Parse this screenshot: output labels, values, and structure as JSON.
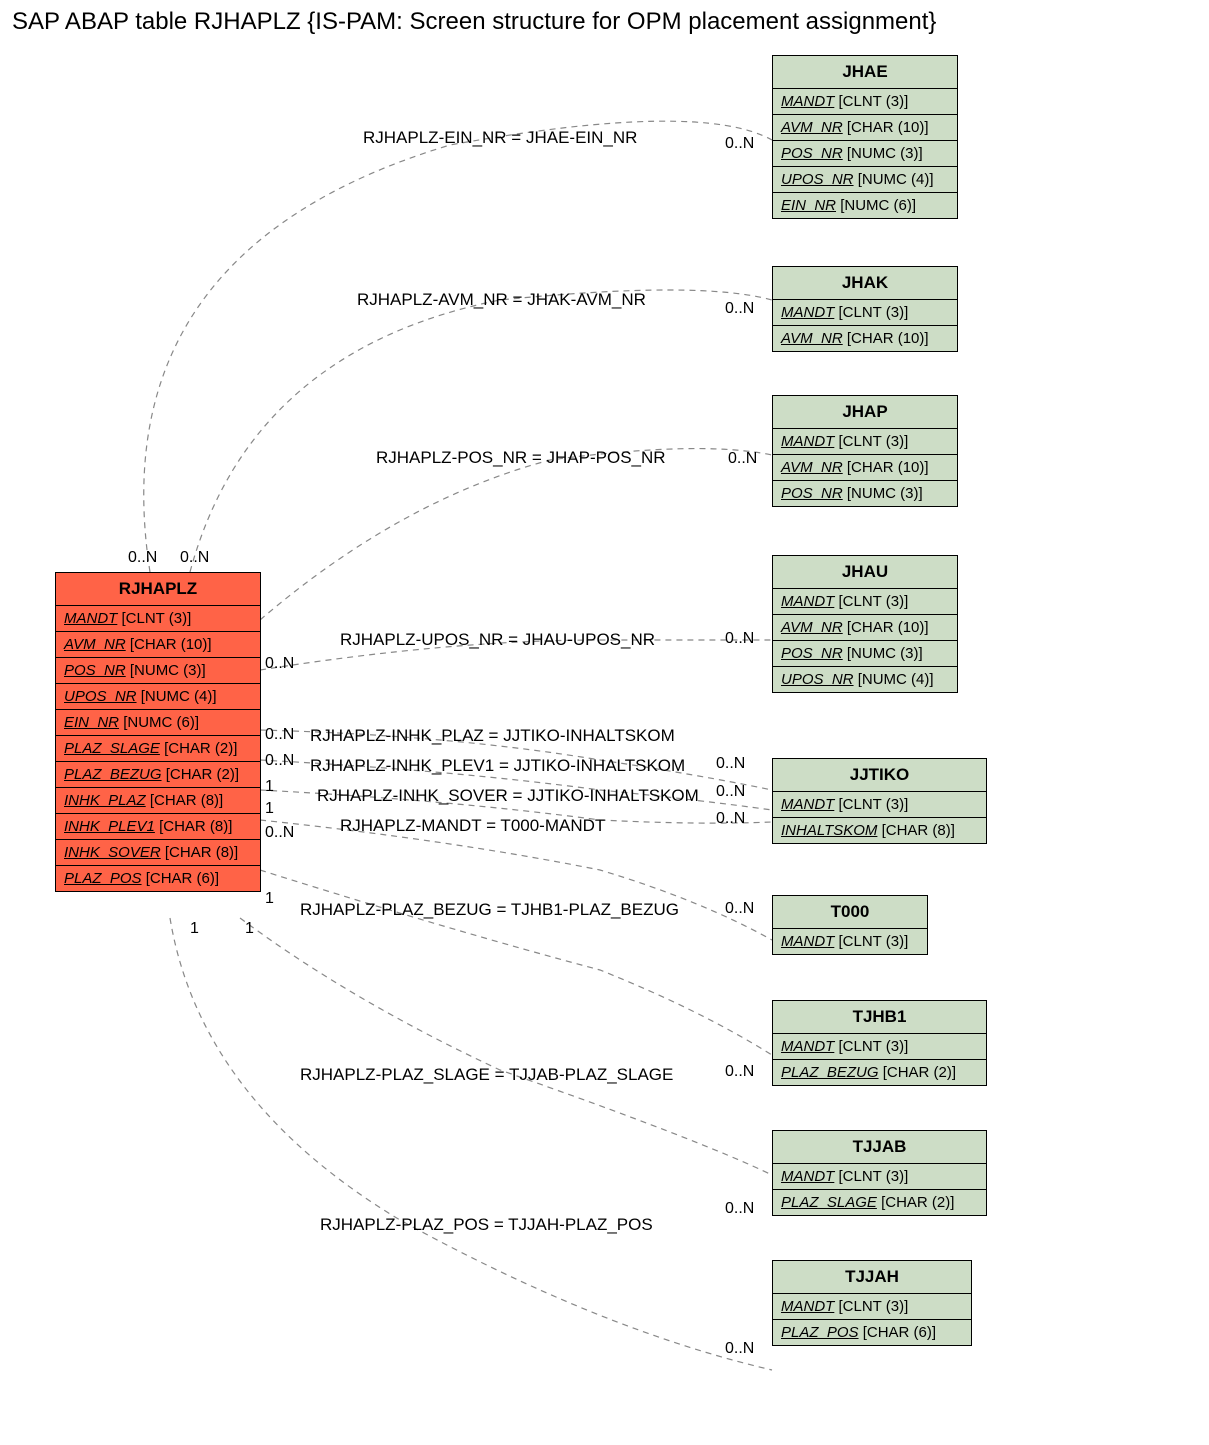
{
  "title": "SAP ABAP table RJHAPLZ {IS-PAM: Screen structure for OPM placement assignment}",
  "main": {
    "name": "RJHAPLZ",
    "fields": [
      {
        "name": "MANDT",
        "type": "[CLNT (3)]"
      },
      {
        "name": "AVM_NR",
        "type": "[CHAR (10)]"
      },
      {
        "name": "POS_NR",
        "type": "[NUMC (3)]"
      },
      {
        "name": "UPOS_NR",
        "type": "[NUMC (4)]"
      },
      {
        "name": "EIN_NR",
        "type": "[NUMC (6)]"
      },
      {
        "name": "PLAZ_SLAGE",
        "type": "[CHAR (2)]"
      },
      {
        "name": "PLAZ_BEZUG",
        "type": "[CHAR (2)]"
      },
      {
        "name": "INHK_PLAZ",
        "type": "[CHAR (8)]"
      },
      {
        "name": "INHK_PLEV1",
        "type": "[CHAR (8)]"
      },
      {
        "name": "INHK_SOVER",
        "type": "[CHAR (8)]"
      },
      {
        "name": "PLAZ_POS",
        "type": "[CHAR (6)]"
      }
    ]
  },
  "related": [
    {
      "name": "JHAE",
      "fields": [
        {
          "name": "MANDT",
          "type": "[CLNT (3)]"
        },
        {
          "name": "AVM_NR",
          "type": "[CHAR (10)]"
        },
        {
          "name": "POS_NR",
          "type": "[NUMC (3)]"
        },
        {
          "name": "UPOS_NR",
          "type": "[NUMC (4)]"
        },
        {
          "name": "EIN_NR",
          "type": "[NUMC (6)]"
        }
      ]
    },
    {
      "name": "JHAK",
      "fields": [
        {
          "name": "MANDT",
          "type": "[CLNT (3)]"
        },
        {
          "name": "AVM_NR",
          "type": "[CHAR (10)]"
        }
      ]
    },
    {
      "name": "JHAP",
      "fields": [
        {
          "name": "MANDT",
          "type": "[CLNT (3)]"
        },
        {
          "name": "AVM_NR",
          "type": "[CHAR (10)]"
        },
        {
          "name": "POS_NR",
          "type": "[NUMC (3)]"
        }
      ]
    },
    {
      "name": "JHAU",
      "fields": [
        {
          "name": "MANDT",
          "type": "[CLNT (3)]"
        },
        {
          "name": "AVM_NR",
          "type": "[CHAR (10)]"
        },
        {
          "name": "POS_NR",
          "type": "[NUMC (3)]"
        },
        {
          "name": "UPOS_NR",
          "type": "[NUMC (4)]"
        }
      ]
    },
    {
      "name": "JJTIKO",
      "fields": [
        {
          "name": "MANDT",
          "type": "[CLNT (3)]"
        },
        {
          "name": "INHALTSKOM",
          "type": "[CHAR (8)]"
        }
      ]
    },
    {
      "name": "T000",
      "fields": [
        {
          "name": "MANDT",
          "type": "[CLNT (3)]"
        }
      ]
    },
    {
      "name": "TJHB1",
      "fields": [
        {
          "name": "MANDT",
          "type": "[CLNT (3)]"
        },
        {
          "name": "PLAZ_BEZUG",
          "type": "[CHAR (2)]"
        }
      ]
    },
    {
      "name": "TJJAB",
      "fields": [
        {
          "name": "MANDT",
          "type": "[CLNT (3)]"
        },
        {
          "name": "PLAZ_SLAGE",
          "type": "[CHAR (2)]"
        }
      ]
    },
    {
      "name": "TJJAH",
      "fields": [
        {
          "name": "MANDT",
          "type": "[CLNT (3)]"
        },
        {
          "name": "PLAZ_POS",
          "type": "[CHAR (6)]"
        }
      ]
    }
  ],
  "edges": [
    {
      "label": "RJHAPLZ-EIN_NR = JHAE-EIN_NR",
      "left_card": "0..N",
      "right_card": "0..N"
    },
    {
      "label": "RJHAPLZ-AVM_NR = JHAK-AVM_NR",
      "left_card": "0..N",
      "right_card": "0..N"
    },
    {
      "label": "RJHAPLZ-POS_NR = JHAP-POS_NR",
      "left_card": "",
      "right_card": "0..N"
    },
    {
      "label": "RJHAPLZ-UPOS_NR = JHAU-UPOS_NR",
      "left_card": "0..N",
      "right_card": "0..N"
    },
    {
      "label": "RJHAPLZ-INHK_PLAZ = JJTIKO-INHALTSKOM",
      "left_card": "0..N",
      "right_card": "0..N"
    },
    {
      "label": "RJHAPLZ-INHK_PLEV1 = JJTIKO-INHALTSKOM",
      "left_card": "0..N",
      "right_card": "0..N"
    },
    {
      "label": "RJHAPLZ-INHK_SOVER = JJTIKO-INHALTSKOM",
      "left_card": "1",
      "right_card": "0..N"
    },
    {
      "label": "RJHAPLZ-MANDT = T000-MANDT",
      "left_card": "1",
      "right_card": ""
    },
    {
      "label": "RJHAPLZ-PLAZ_BEZUG = TJHB1-PLAZ_BEZUG",
      "left_card": "0..N",
      "right_card": "0..N"
    },
    {
      "label": "RJHAPLZ-PLAZ_SLAGE = TJJAB-PLAZ_SLAGE",
      "left_card": "1",
      "right_card": "0..N"
    },
    {
      "label": "RJHAPLZ-PLAZ_POS = TJJAH-PLAZ_POS",
      "left_card": "1",
      "right_card": "0..N"
    }
  ],
  "extra_cards": [
    "1",
    "1",
    "0..N"
  ]
}
